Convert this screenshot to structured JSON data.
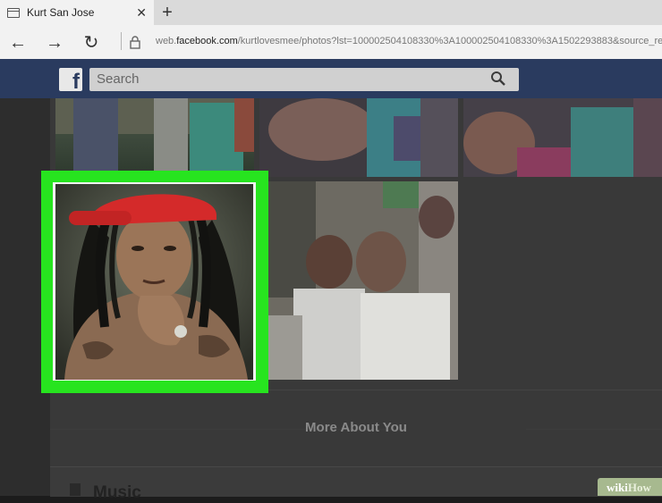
{
  "browser": {
    "tab_title": "Kurt San Jose",
    "tab_close": "✕",
    "new_tab": "+",
    "back": "←",
    "forward": "→",
    "refresh": "↻",
    "url_prefix": "web.",
    "url_domain": "facebook.com",
    "url_path": "/kurtlovesmee/photos?lst=100002504108330%3A100002504108330%3A1502293883&source_re"
  },
  "facebook": {
    "logo": "f",
    "search_placeholder": "Search"
  },
  "profile": {
    "section_title": "More About You",
    "music_label": "Music"
  },
  "badge": {
    "wiki": "wiki",
    "how": "How"
  },
  "colors": {
    "highlight": "#27e41f",
    "fb_blue": "#2a3b5f",
    "red_cap": "#d42a2a"
  }
}
